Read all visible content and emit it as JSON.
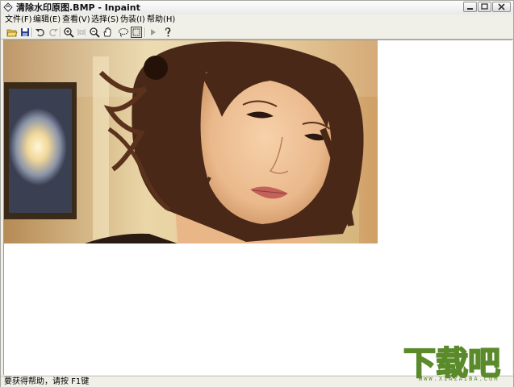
{
  "window": {
    "title": "清除水印原图.BMP - Inpaint",
    "controls": [
      "minimize",
      "maximize",
      "close"
    ]
  },
  "menu": [
    {
      "label": "文件(F)"
    },
    {
      "label": "编辑(E)"
    },
    {
      "label": "查看(V)"
    },
    {
      "label": "选择(S)"
    },
    {
      "label": "伪装(I)"
    },
    {
      "label": "帮助(H)"
    }
  ],
  "toolbar": {
    "icons": [
      "open-folder-icon",
      "save-icon",
      "undo-icon",
      "redo-icon",
      "zoom-in-icon",
      "fit-icon",
      "zoom-out-icon",
      "hand-pan-icon",
      "lasso-icon",
      "rect-select-icon",
      "run-icon",
      "help-icon"
    ],
    "active": "rect-select-icon"
  },
  "status": {
    "text": "要获得帮助，请按 F1键"
  },
  "watermark": {
    "logo_text": "下载吧",
    "site": "WWW.XIAZAIBA.COM"
  },
  "colors": {
    "chrome": "#f0efe8",
    "canvas": "#ffffff",
    "watermark_green": "#5a8a2a"
  }
}
